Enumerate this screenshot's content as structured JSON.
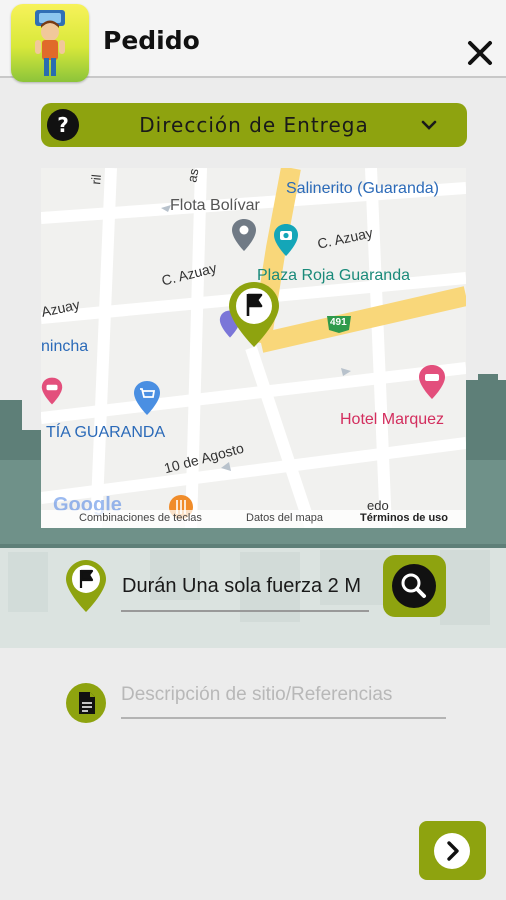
{
  "header": {
    "title": "Pedido",
    "close_icon": "close-icon"
  },
  "delivery_section": {
    "label": "Dirección de Entrega",
    "help_icon": "help-icon",
    "expand_icon": "chevron-down-icon"
  },
  "map": {
    "streets": [
      "C. Azuay",
      "C. Azuay",
      "Azuay",
      "10 de Agosto",
      "ril",
      "as",
      "edo"
    ],
    "places": [
      "Flota Bolívar",
      "Salinerito (Guaranda)",
      "Plaza Roja Guaranda",
      "TÍA GUARANDA",
      "Hotel Marquez",
      "nincha"
    ],
    "route_shield": "491",
    "provider_logo": "Google",
    "footer": {
      "shortcuts": "Combinaciones de teclas",
      "map_data": "Datos del mapa",
      "terms": "Términos de uso"
    },
    "colors": {
      "main_road": "#f9d77a",
      "streets": "#ffffff",
      "pin": "#8ea30f"
    }
  },
  "address": {
    "value": "Durán Una sola fuerza 2 M",
    "pin_icon": "flag-pin-icon",
    "search_icon": "search-icon"
  },
  "description": {
    "placeholder": "Descripción de sitio/Referencias",
    "value": "",
    "doc_icon": "document-icon"
  },
  "next": {
    "icon": "chevron-right-icon"
  },
  "colors": {
    "accent": "#8ea30f",
    "background": "#ececec",
    "header": "#f4f4f4"
  }
}
